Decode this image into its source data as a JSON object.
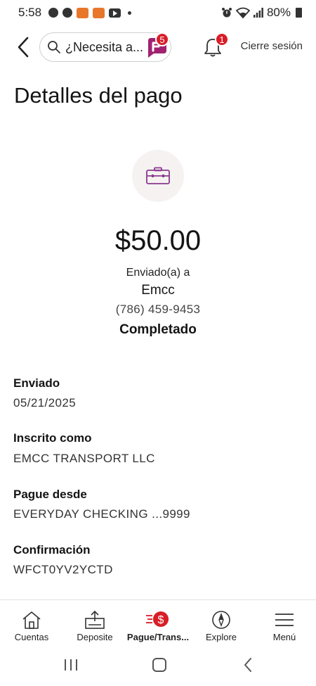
{
  "status_bar": {
    "time": "5:58",
    "battery": "80%"
  },
  "header": {
    "search_placeholder": "¿Necesita a...",
    "assistant_count": "5",
    "notification_count": "1",
    "logout_label": "Cierre sesión"
  },
  "page": {
    "title": "Detalles del pago",
    "amount": "$50.00",
    "sent_to_label": "Enviado(a) a",
    "payee_name": "Emcc",
    "payee_phone": "(786) 459-9453",
    "status": "Completado"
  },
  "details": [
    {
      "label": "Enviado",
      "value": "05/21/2025"
    },
    {
      "label": "Inscrito como",
      "value": "EMCC TRANSPORT LLC"
    },
    {
      "label": "Pague desde",
      "value": "EVERYDAY CHECKING ...9999"
    },
    {
      "label": "Confirmación",
      "value": "WFCT0YV2YCTD"
    }
  ],
  "bottom_nav": {
    "items": [
      {
        "label": "Cuentas",
        "icon": "home-icon"
      },
      {
        "label": "Deposite",
        "icon": "deposit-icon"
      },
      {
        "label": "Pague/Trans...",
        "icon": "pay-transfer-icon",
        "active": true
      },
      {
        "label": "Explore",
        "icon": "compass-icon"
      },
      {
        "label": "Menú",
        "icon": "menu-icon"
      }
    ]
  },
  "colors": {
    "accent_red": "#d71e28",
    "wallet_purple": "#8a3a8f",
    "icon_bg": "#f5f2f1"
  }
}
